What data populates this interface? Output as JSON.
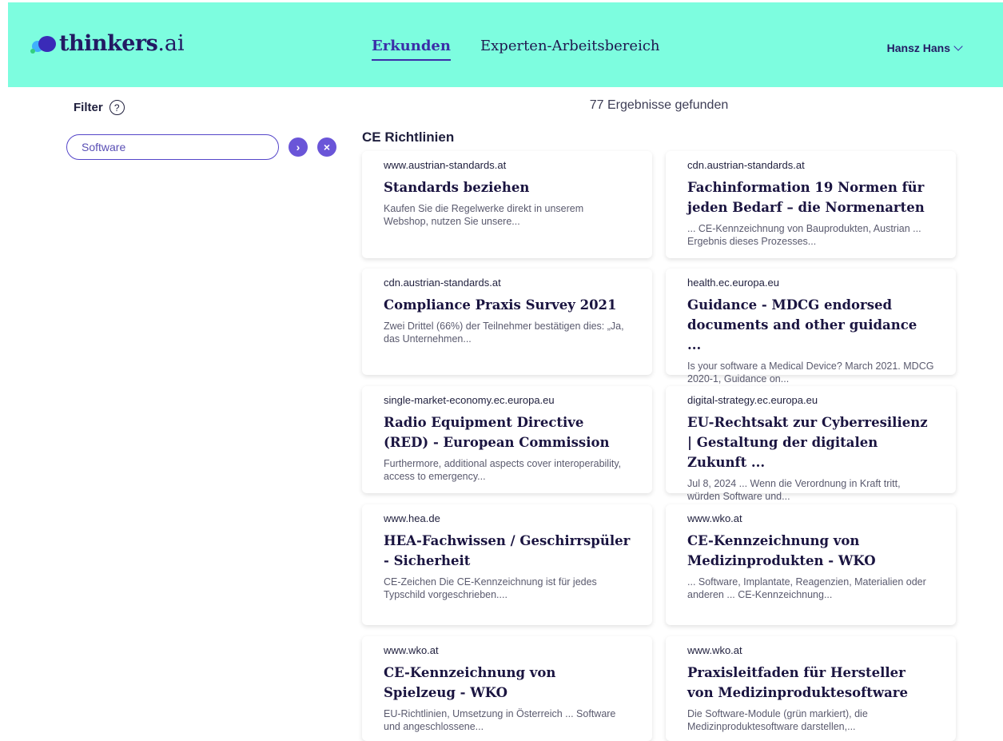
{
  "header": {
    "logo_text": "thinkers",
    "logo_suffix": ".ai",
    "nav": [
      {
        "label": "Erkunden"
      },
      {
        "label": "Experten-Arbeitsbereich"
      }
    ],
    "user_name": "Hansz Hans"
  },
  "filter": {
    "title": "Filter",
    "help_glyph": "?",
    "search_value": "Software",
    "go_glyph": "›",
    "clear_glyph": "×"
  },
  "results": {
    "count_text": "77 Ergebnisse gefunden",
    "section_title": "CE Richtlinien",
    "cards": [
      {
        "domain": "www.austrian-standards.at",
        "title": "Standards beziehen",
        "snippet": "Kaufen Sie die Regelwerke direkt in unserem Webshop, nutzen Sie unsere..."
      },
      {
        "domain": "cdn.austrian-standards.at",
        "title": "Fachinformation 19 Normen für jeden Bedarf – die Normenarten",
        "snippet": "... CE-Kennzeichnung von Bauprodukten, Austrian ... Ergebnis dieses Prozesses..."
      },
      {
        "domain": "cdn.austrian-standards.at",
        "title": "Compliance Praxis Survey 2021",
        "snippet": "Zwei Drittel (66%) der Teilnehmer bestätigen dies: „Ja, das Unternehmen..."
      },
      {
        "domain": "health.ec.europa.eu",
        "title": "Guidance - MDCG endorsed documents and other guidance ...",
        "snippet": "Is your software a Medical Device? March 2021. MDCG 2020-1, Guidance on..."
      },
      {
        "domain": "single-market-economy.ec.europa.eu",
        "title": "Radio Equipment Directive (RED) - European Commission",
        "snippet": "Furthermore, additional aspects cover interoperability, access to emergency..."
      },
      {
        "domain": "digital-strategy.ec.europa.eu",
        "title": "EU-Rechtsakt zur Cyberresilienz | Gestaltung der digitalen Zukunft ...",
        "snippet": "Jul 8, 2024 ... Wenn die Verordnung in Kraft tritt, würden Software und..."
      },
      {
        "domain": "www.hea.de",
        "title": "HEA-Fachwissen / Geschirrspüler - Sicherheit",
        "snippet": "CE-Zeichen Die CE-Kennzeichnung ist für jedes Typschild vorgeschrieben...."
      },
      {
        "domain": "www.wko.at",
        "title": "CE-Kennzeichnung von Medizinprodukten - WKO",
        "snippet": "... Software, Implantate, Reagenzien, Materialien oder anderen ... CE-Kennzeichnung..."
      },
      {
        "domain": "www.wko.at",
        "title": "CE-Kennzeichnung von Spielzeug - WKO",
        "snippet": "EU-Richtlinien, Umsetzung in Österreich ... Software und angeschlossene..."
      },
      {
        "domain": "www.wko.at",
        "title": "Praxisleitfaden für Hersteller von Medizinproduktesoftware",
        "snippet": "Die Software-Module (grün markiert), die Medizinproduktesoftware darstellen,..."
      }
    ]
  }
}
